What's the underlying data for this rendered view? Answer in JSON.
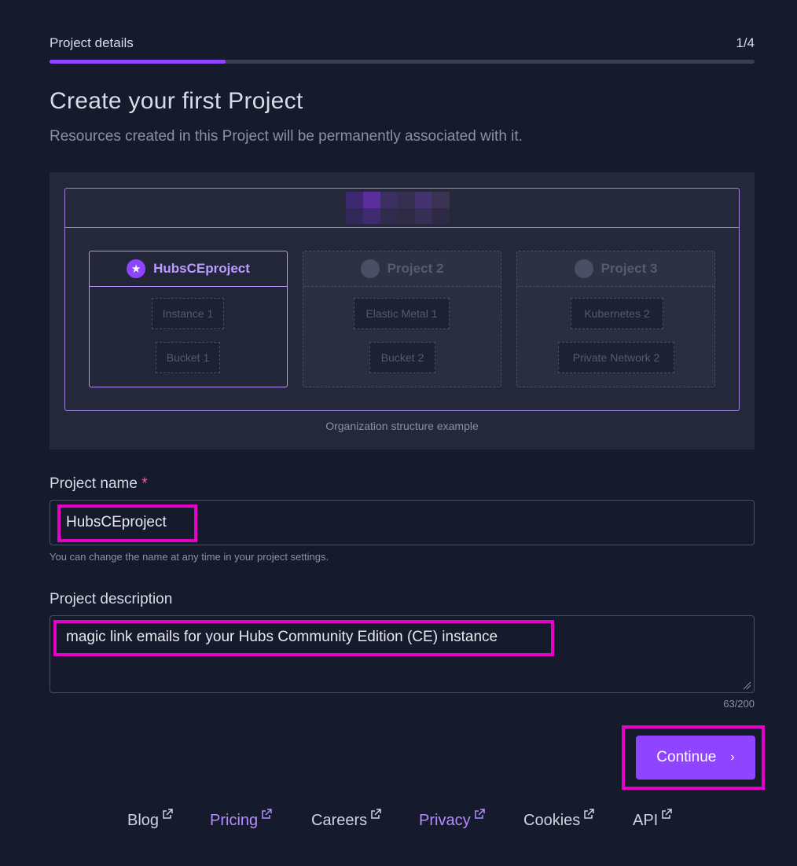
{
  "progress": {
    "step_label": "Project details",
    "step_count": "1/4",
    "fraction": 0.25
  },
  "title": "Create your first Project",
  "subtitle": "Resources created in this Project will be permanently associated with it.",
  "illustration": {
    "caption": "Organization structure example",
    "projects": [
      {
        "name": "HubsCEproject",
        "icon": "star-icon",
        "resources": [
          "Instance 1",
          "Bucket 1"
        ]
      },
      {
        "name": "Project 2",
        "icon": "circle-icon",
        "resources": [
          "Elastic Metal 1",
          "Bucket 2"
        ]
      },
      {
        "name": "Project 3",
        "icon": "circle-icon",
        "resources": [
          "Kubernetes 2",
          "Private Network 2"
        ]
      }
    ]
  },
  "form": {
    "name_label": "Project name",
    "name_required_mark": "*",
    "name_value": "HubsCEproject",
    "name_hint": "You can change the name at any time in your project settings.",
    "description_label": "Project description",
    "description_value": "magic link emails for your Hubs Community Edition (CE) instance",
    "description_counter": "63/200"
  },
  "actions": {
    "continue_label": "Continue",
    "continue_icon": "chevron-right-icon"
  },
  "footer": {
    "links": [
      {
        "label": "Blog"
      },
      {
        "label": "Pricing"
      },
      {
        "label": "Careers"
      },
      {
        "label": "Privacy"
      },
      {
        "label": "Cookies"
      },
      {
        "label": "API"
      }
    ]
  },
  "colors": {
    "background": "#161a2d",
    "accent": "#8f44ff",
    "highlight": "#e600c8",
    "link_purple": "#b58cff",
    "required": "#ff5fa8"
  }
}
